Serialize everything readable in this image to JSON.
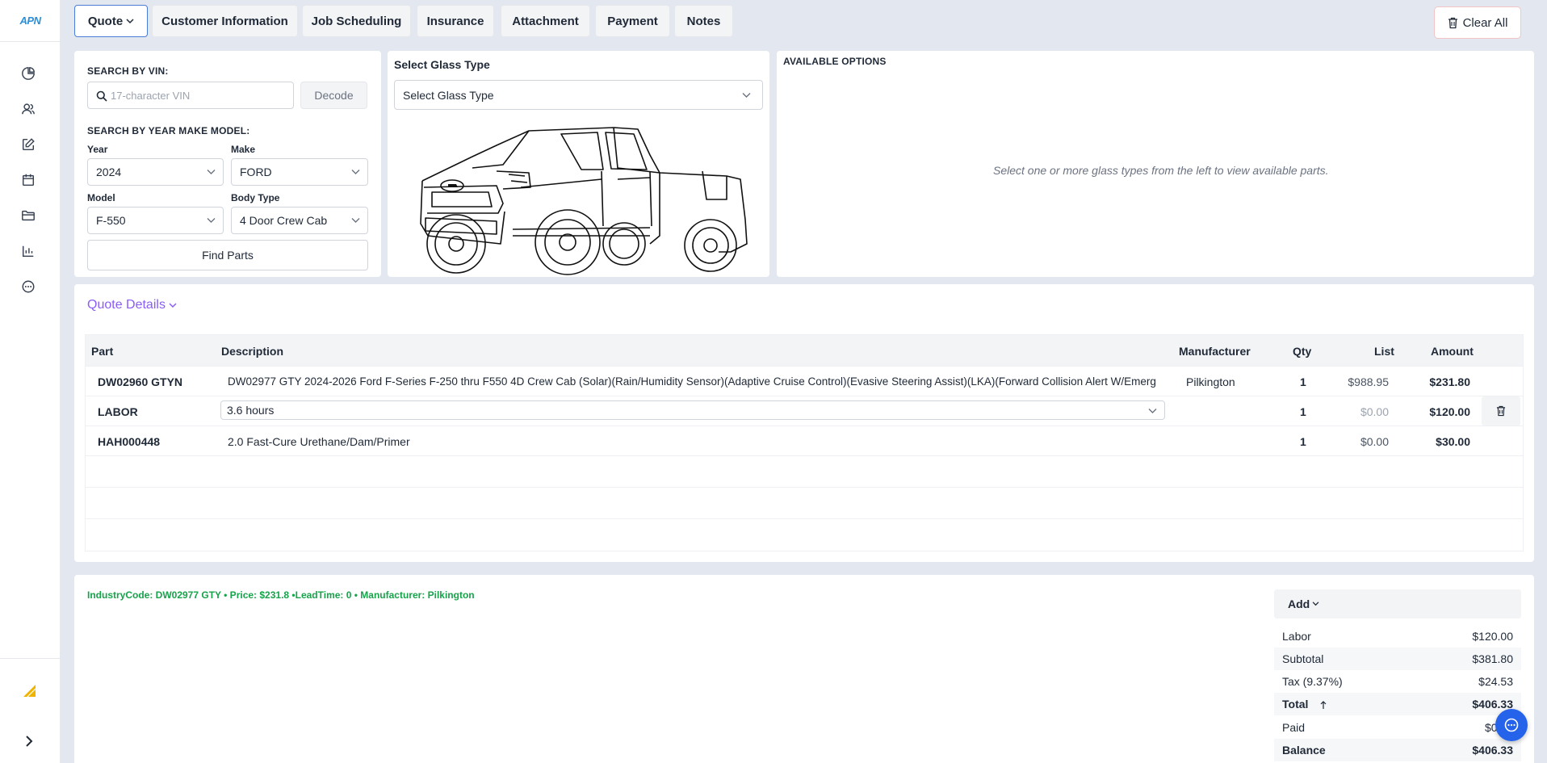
{
  "app": {
    "logo_text": "APN"
  },
  "sidebar": {
    "icons": [
      "chart-pie-icon",
      "users-icon",
      "edit-icon",
      "calendar-icon",
      "folder-icon",
      "bar-chart-icon",
      "chat-icon"
    ]
  },
  "tabs": [
    {
      "label": "Quote"
    },
    {
      "label": "Customer Information"
    },
    {
      "label": "Job Scheduling"
    },
    {
      "label": "Insurance"
    },
    {
      "label": "Attachment"
    },
    {
      "label": "Payment"
    },
    {
      "label": "Notes"
    }
  ],
  "toolbar": {
    "clear_all": "Clear All"
  },
  "search": {
    "vin_heading": "SEARCH BY VIN:",
    "vin_placeholder": "17-character VIN",
    "decode_label": "Decode",
    "ymm_heading": "SEARCH BY YEAR MAKE MODEL:",
    "year_label": "Year",
    "year_value": "2024",
    "make_label": "Make",
    "make_value": "FORD",
    "model_label": "Model",
    "model_value": "F-550",
    "body_label": "Body Type",
    "body_value": "4 Door Crew Cab",
    "find_parts": "Find Parts"
  },
  "glass": {
    "heading": "Select Glass Type",
    "select_value": "Select Glass Type"
  },
  "options": {
    "heading": "AVAILABLE OPTIONS",
    "empty_text": "Select one or more glass types from the left to view available parts."
  },
  "quote": {
    "title": "Quote Details",
    "columns": {
      "part": "Part",
      "description": "Description",
      "manufacturer": "Manufacturer",
      "qty": "Qty",
      "list": "List",
      "amount": "Amount"
    },
    "rows": [
      {
        "part": "DW02960 GTYN",
        "description": "DW02977 GTY 2024-2026 Ford F-Series F-250 thru F550 4D Crew Cab (Solar)(Rain/Humidity Sensor)(Adaptive Cruise Control)(Evasive Steering Assist)(LKA)(Forward Collision Alert W/Emerg",
        "manufacturer": "Pilkington",
        "qty": "1",
        "list": "$988.95",
        "amount": "$231.80"
      },
      {
        "part": "LABOR",
        "description": "3.6 hours",
        "manufacturer": "",
        "qty": "1",
        "list": "$0.00",
        "amount": "$120.00"
      },
      {
        "part": "HAH000448",
        "description": "2.0 Fast-Cure Urethane/Dam/Primer",
        "manufacturer": "",
        "qty": "1",
        "list": "$0.00",
        "amount": "$30.00"
      }
    ]
  },
  "footer": {
    "industry_info": "IndustryCode: DW02977 GTY • Price: $231.8 •LeadTime: 0 • Manufacturer: Pilkington",
    "add_label": "Add",
    "summary": {
      "labor_k": "Labor",
      "labor_v": "$120.00",
      "subtotal_k": "Subtotal",
      "subtotal_v": "$381.80",
      "tax_k": "Tax (9.37%)",
      "tax_v": "$24.53",
      "total_k": "Total",
      "total_v": "$406.33",
      "paid_k": "Paid",
      "paid_v": "$0.00",
      "balance_k": "Balance",
      "balance_v": "$406.33"
    }
  },
  "colors": {
    "accent": "#4a7dd8",
    "link_purple": "#8b5cf6",
    "success_green": "#16a34a",
    "chat_blue": "#2563eb"
  }
}
